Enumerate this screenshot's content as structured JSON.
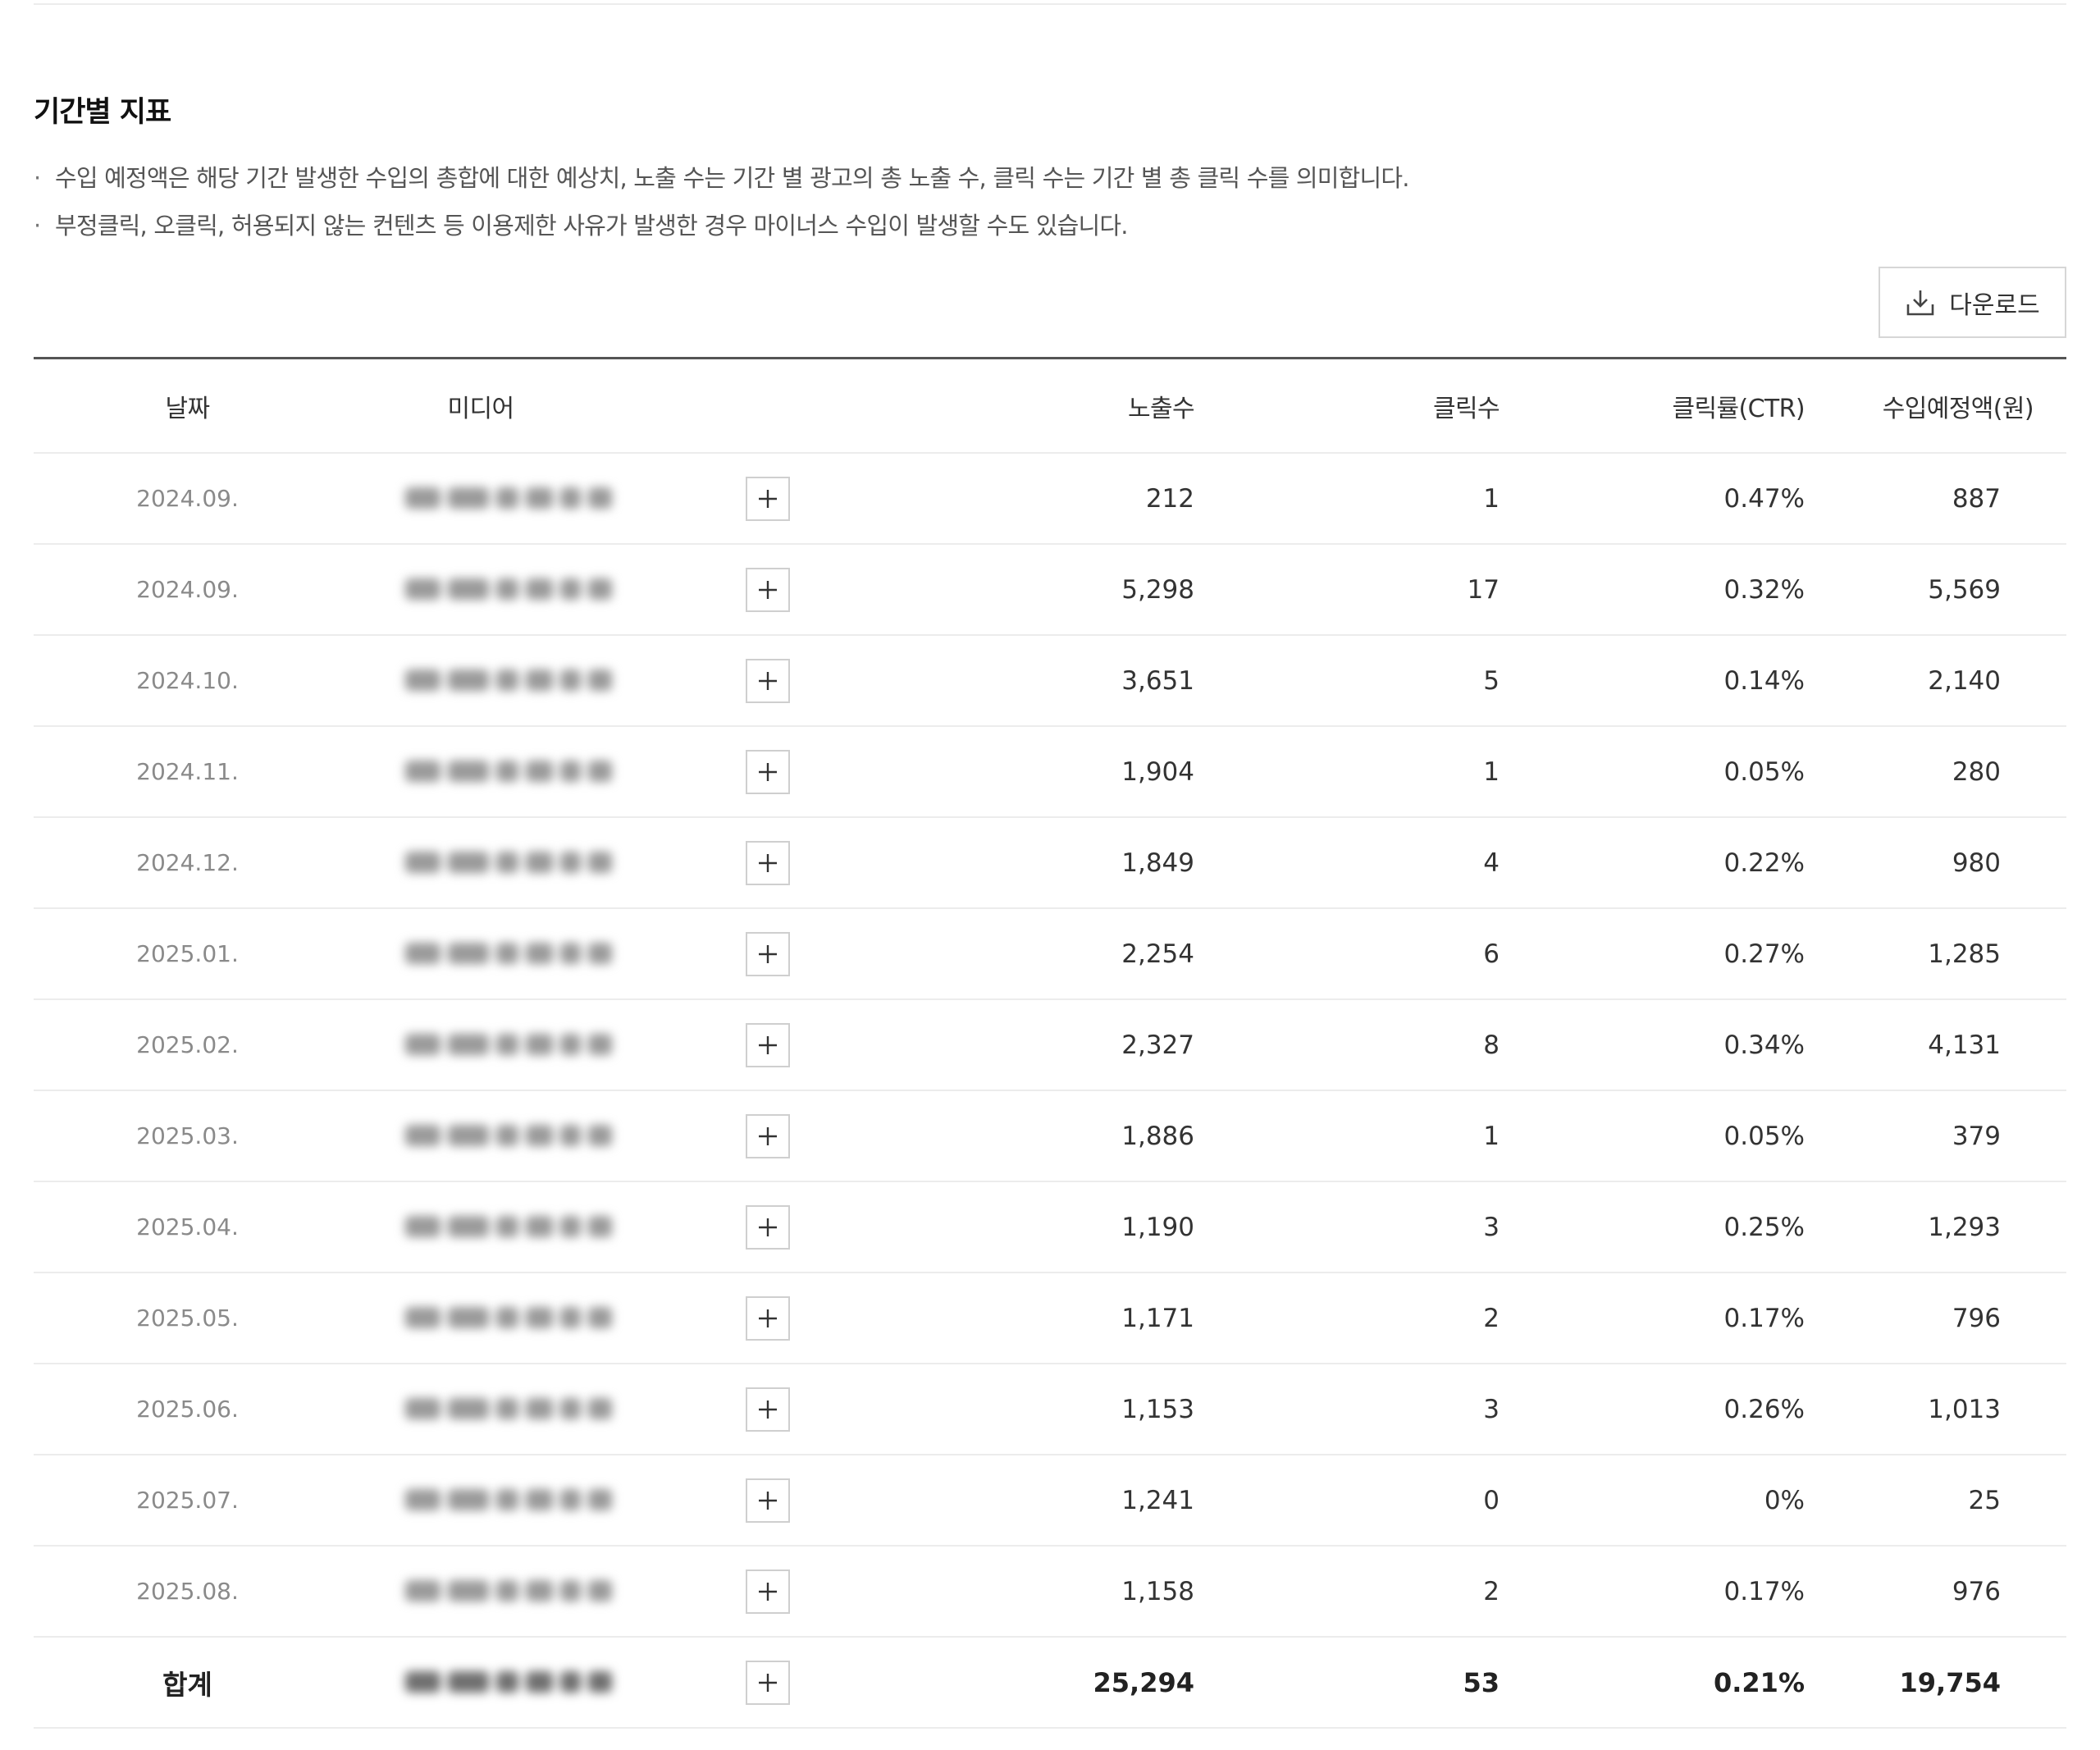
{
  "section": {
    "title": "기간별 지표",
    "notes": [
      "수입 예정액은 해당 기간 발생한 수입의 총합에 대한 예상치, 노출 수는 기간 별 광고의 총 노출 수, 클릭 수는 기간 별 총 클릭 수를 의미합니다.",
      "부정클릭, 오클릭, 허용되지 않는 컨텐츠 등 이용제한 사유가 발생한 경우 마이너스 수입이 발생할 수도 있습니다."
    ],
    "bullet": "·"
  },
  "toolbar": {
    "download_label": "다운로드",
    "download_icon": "download-icon"
  },
  "table": {
    "headers": {
      "date": "날짜",
      "media": "미디어",
      "exposures": "노출수",
      "clicks": "클릭수",
      "ctr": "클릭률(CTR)",
      "revenue": "수입예정액(원)"
    },
    "expand_icon": "plus-icon",
    "rows": [
      {
        "date": "2024.09.",
        "exposures": "212",
        "clicks": "1",
        "ctr": "0.47%",
        "revenue": "887"
      },
      {
        "date": "2024.09.",
        "exposures": "5,298",
        "clicks": "17",
        "ctr": "0.32%",
        "revenue": "5,569"
      },
      {
        "date": "2024.10.",
        "exposures": "3,651",
        "clicks": "5",
        "ctr": "0.14%",
        "revenue": "2,140"
      },
      {
        "date": "2024.11.",
        "exposures": "1,904",
        "clicks": "1",
        "ctr": "0.05%",
        "revenue": "280"
      },
      {
        "date": "2024.12.",
        "exposures": "1,849",
        "clicks": "4",
        "ctr": "0.22%",
        "revenue": "980"
      },
      {
        "date": "2025.01.",
        "exposures": "2,254",
        "clicks": "6",
        "ctr": "0.27%",
        "revenue": "1,285"
      },
      {
        "date": "2025.02.",
        "exposures": "2,327",
        "clicks": "8",
        "ctr": "0.34%",
        "revenue": "4,131"
      },
      {
        "date": "2025.03.",
        "exposures": "1,886",
        "clicks": "1",
        "ctr": "0.05%",
        "revenue": "379"
      },
      {
        "date": "2025.04.",
        "exposures": "1,190",
        "clicks": "3",
        "ctr": "0.25%",
        "revenue": "1,293"
      },
      {
        "date": "2025.05.",
        "exposures": "1,171",
        "clicks": "2",
        "ctr": "0.17%",
        "revenue": "796"
      },
      {
        "date": "2025.06.",
        "exposures": "1,153",
        "clicks": "3",
        "ctr": "0.26%",
        "revenue": "1,013"
      },
      {
        "date": "2025.07.",
        "exposures": "1,241",
        "clicks": "0",
        "ctr": "0%",
        "revenue": "25"
      },
      {
        "date": "2025.08.",
        "exposures": "1,158",
        "clicks": "2",
        "ctr": "0.17%",
        "revenue": "976"
      }
    ],
    "total": {
      "date": "합계",
      "exposures": "25,294",
      "clicks": "53",
      "ctr": "0.21%",
      "revenue": "19,754"
    }
  },
  "colors": {
    "header_rule": "#555555",
    "row_divider": "#ececec",
    "muted_text": "#8a8a8a",
    "text": "#333333"
  }
}
